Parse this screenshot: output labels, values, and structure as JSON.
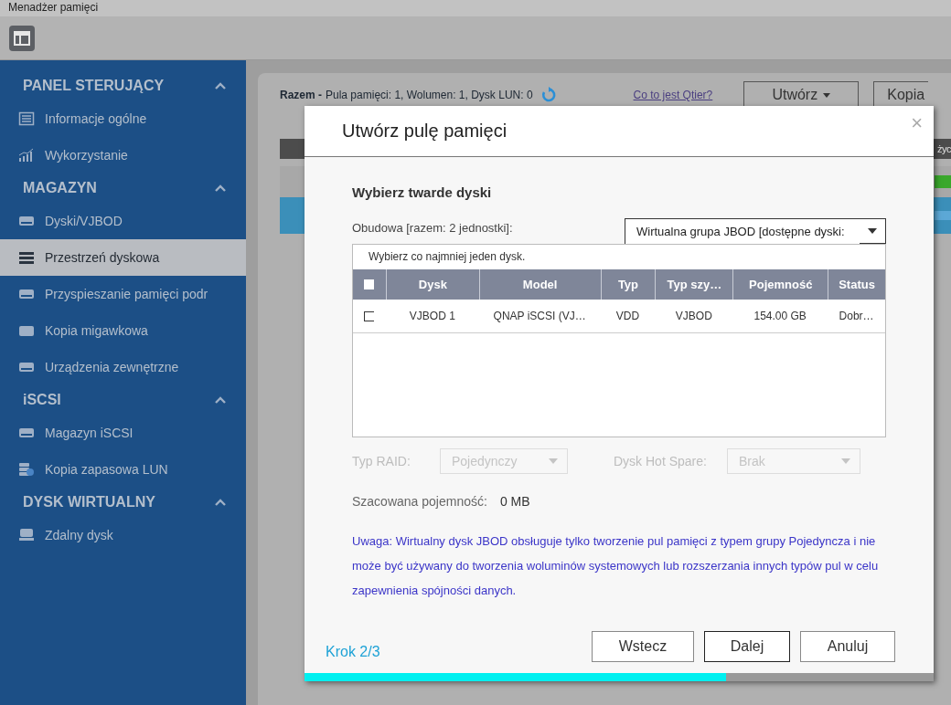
{
  "window": {
    "title": "Menadżer pamięci"
  },
  "sidebar": {
    "sections": [
      {
        "title": "PANEL STERUJĄCY",
        "expanded": true,
        "items": [
          {
            "label": "Informacje ogólne",
            "kind": "list",
            "selected": false
          },
          {
            "label": "Wykorzystanie",
            "kind": "chart",
            "selected": false
          }
        ]
      },
      {
        "title": "MAGAZYN",
        "expanded": true,
        "items": [
          {
            "label": "Dyski/VJBOD",
            "kind": "disk",
            "selected": false
          },
          {
            "label": "Przestrzeń dyskowa",
            "kind": "stack",
            "selected": true
          },
          {
            "label": "Przyspieszanie pamięci podr",
            "kind": "disk",
            "selected": false
          },
          {
            "label": "Kopia migawkowa",
            "kind": "snapshot",
            "selected": false
          },
          {
            "label": "Urządzenia zewnętrzne",
            "kind": "disk",
            "selected": false
          }
        ]
      },
      {
        "title": "iSCSI",
        "expanded": true,
        "items": [
          {
            "label": "Magazyn iSCSI",
            "kind": "drive",
            "selected": false
          },
          {
            "label": "Kopia zapasowa LUN",
            "kind": "backup",
            "selected": false
          }
        ]
      },
      {
        "title": "DYSK WIRTUALNY",
        "expanded": true,
        "items": [
          {
            "label": "Zdalny dysk",
            "kind": "remote",
            "selected": false
          }
        ]
      }
    ]
  },
  "summary": {
    "label": "Razem -",
    "text": "Pula pamięci:  1, Wolumen:  1, Dysk LUN:  0",
    "link": "Co to jest Qtier?",
    "buttons": [
      "Utwórz",
      "Kopia"
    ],
    "column_fragment": "życ"
  },
  "dialog": {
    "title": "Utwórz pulę pamięci",
    "close": "×",
    "heading": "Wybierz twarde dyski",
    "enclosure_label": "Obudowa [razem: 2 jednostki]:",
    "enclosure_value": "Wirtualna grupa JBOD [dostępne dyski:",
    "hint": "Wybierz co najmniej jeden dysk.",
    "table": {
      "all_checked": false,
      "columns": [
        "Dysk",
        "Model",
        "Typ",
        "Typ szy…",
        "Pojemność",
        "Status"
      ],
      "rows": [
        {
          "checked": false,
          "cells": [
            "VJBOD 1",
            "QNAP iSCSI (VJ…",
            "VDD",
            "VJBOD",
            "154.00 GB",
            "Dobr…"
          ]
        }
      ]
    },
    "raid": {
      "label": "Typ RAID:",
      "value": "Pojedynczy",
      "disabled": true
    },
    "hot_spare": {
      "label": "Dysk Hot Spare:",
      "value": "Brak",
      "disabled": true
    },
    "capacity": {
      "label": "Szacowana pojemność:",
      "value": "0 MB"
    },
    "note": "Uwaga: Wirtualny dysk JBOD obsługuje tylko tworzenie pul pamięci z typem grupy Pojedyncza i nie może być używany do tworzenia woluminów systemowych lub rozszerzania innych typów pul w celu zapewnienia spójności danych.",
    "step": "Krok 2/3",
    "buttons": [
      {
        "label": "Wstecz",
        "default": false
      },
      {
        "label": "Dalej",
        "default": true
      },
      {
        "label": "Anuluj",
        "default": false
      }
    ],
    "progress": {
      "level": 0.67
    }
  }
}
